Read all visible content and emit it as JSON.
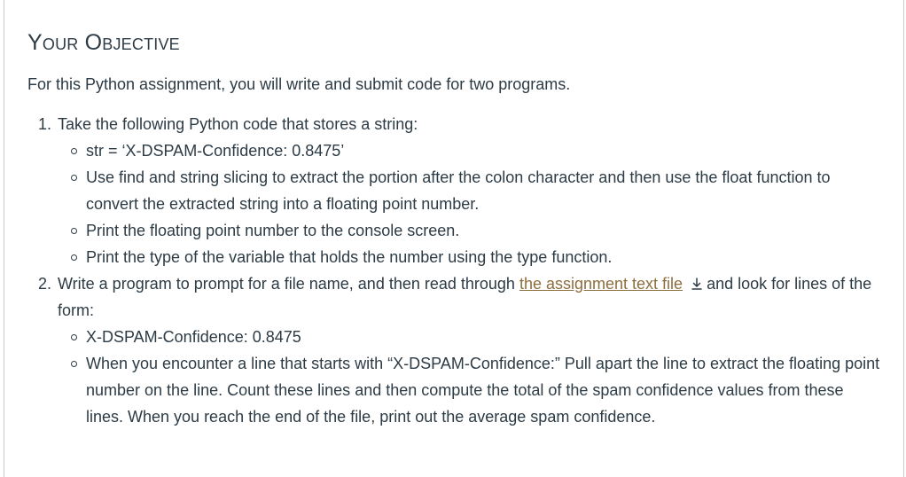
{
  "heading": "Your Objective",
  "intro": "For this Python assignment, you will write and submit code for two programs.",
  "steps": [
    {
      "text": "Take the following Python code that stores a string:",
      "bullets": [
        "str = ‘X-DSPAM-Confidence: 0.8475’",
        "Use find and string slicing to extract the portion after the colon character and then use the float function to convert the extracted string into a floating point number.",
        "Print the floating point number to the console screen.",
        "Print the type of the variable that holds the number using the type function."
      ]
    },
    {
      "text_before": "Write a program to prompt for a file name, and then read through",
      "link_text": "the assignment text file",
      "text_after": "and look for lines of the form:",
      "icon": "download-icon",
      "bullets": [
        "X-DSPAM-Confidence: 0.8475",
        "When you encounter a line that starts with “X-DSPAM-Confidence:” Pull apart the line to extract the floating point number on the line. Count these lines and then compute the total of the spam confidence values from these lines. When you reach the end of the file, print out the average spam confidence."
      ]
    }
  ]
}
